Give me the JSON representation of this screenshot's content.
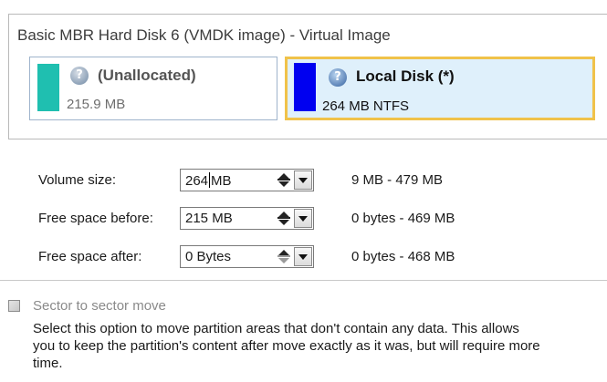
{
  "disk": {
    "title": "Basic MBR Hard Disk 6 (VMDK image) - Virtual Image",
    "partitions": [
      {
        "name": "(Unallocated)",
        "size": "215.9 MB",
        "color": "#1fbfb0",
        "icon": "help-icon",
        "selected": false
      },
      {
        "name": "Local Disk (*)",
        "size": "264 MB NTFS",
        "color": "#0000f0",
        "icon": "help-icon",
        "selected": true
      }
    ]
  },
  "form": {
    "volume_size": {
      "label": "Volume size:",
      "value_before_caret": "264",
      "value_after_caret": "MB",
      "range": "9 MB - 479 MB"
    },
    "free_before": {
      "label": "Free space before:",
      "value": "215 MB",
      "range": "0 bytes - 469 MB"
    },
    "free_after": {
      "label": "Free space after:",
      "value": "0 Bytes",
      "range": "0 bytes - 468 MB"
    }
  },
  "sector_move": {
    "label": "Sector to sector move",
    "checked": false,
    "enabled": false,
    "description_lines": [
      "Select this option to move partition areas that don't contain any data. This allows",
      "you to keep the partition's content after move exactly as it was, but will require more",
      "time."
    ]
  }
}
